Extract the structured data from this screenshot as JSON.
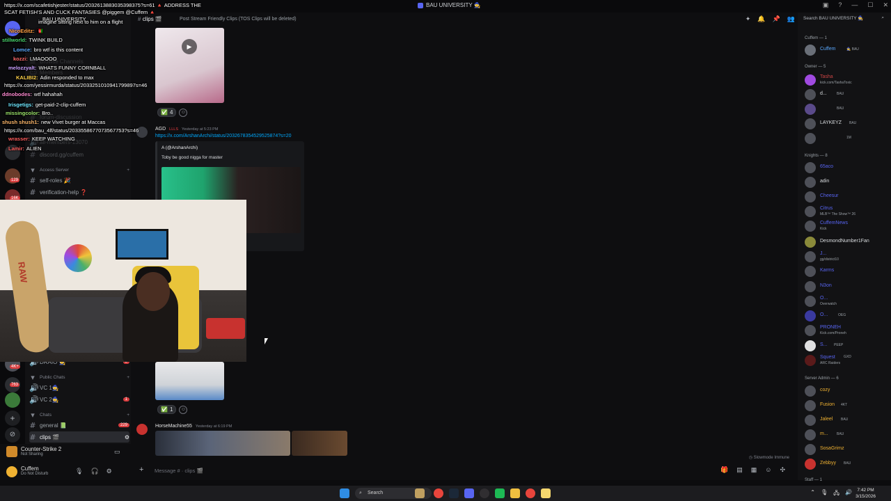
{
  "titlebar": {
    "server": "BAU UNIVERSITY 🧙",
    "icons": [
      "inbox-icon",
      "help-icon",
      "minimize-icon",
      "maximize-icon",
      "close-icon"
    ]
  },
  "overlay_chat": [
    {
      "user": "",
      "text": "https://x.com/scafetishjester/status/2032613883035398375?s=61 🔺 ADDRESS THE",
      "color": "#ffffff"
    },
    {
      "user": "",
      "text": "SCAT FETISH'S AND CUCK FANTASIES @piggem @Cuffem 🔺",
      "color": "#ffffff"
    },
    {
      "user": "",
      "text": "BAU UNIVERSITY",
      "color": "#ffffff"
    },
    {
      "user": "",
      "text": "imagine sitting next to him on a flight",
      "color": "#ffffff"
    },
    {
      "user": "NicoEditz:",
      "text": "🇦🇫",
      "color": "#ff9f43"
    },
    {
      "user": "stillworld:",
      "text": "TWINK BUILD",
      "color": "#4ad66d"
    },
    {
      "user": "Lomce:",
      "text": "bro wtf is this content",
      "color": "#5aa9ff"
    },
    {
      "user": "kozzi:",
      "text": "LMAOOOO",
      "color": "#ff6b6b"
    },
    {
      "user": "melozzyalt:",
      "text": "WHATS FUNNY CORNBALL",
      "color": "#c9a0ff"
    },
    {
      "user": "KALIBI2:",
      "text": "Adin responded to max",
      "color": "#ffd24a"
    },
    {
      "user": "",
      "text": "https://x.com/yessirmurda/status/2033251010941799897s=46",
      "color": "#ffffff"
    },
    {
      "user": "ddnobodes:",
      "text": "wtf hahahah",
      "color": "#ff8ad1"
    },
    {
      "user": "Irisgetigs:",
      "text": "get-paid-2-clip-cuffem",
      "color": "#6ee7ff"
    },
    {
      "user": "missingcolor:",
      "text": "Bro..",
      "color": "#9be36a"
    },
    {
      "user": "shush shush1:",
      "text": "new Vivet burger at Maccas",
      "color": "#ffb86b"
    },
    {
      "user": "",
      "text": "https://x.com/bau_4lf/status/2033558677073567753?s=46",
      "color": "#ffffff"
    },
    {
      "user": "wrasser:",
      "text": "KEEP WATCHING",
      "color": "#ff5e5e"
    },
    {
      "user": "Lamir:",
      "text": "ALIEN",
      "color": "#ff5e5e"
    }
  ],
  "channels": {
    "faded": [
      "Browse Channels",
      "Members",
      "forum-discussion",
      "all-members-13070",
      "discord.gg/cuffem"
    ],
    "access_category": "Access Server",
    "access_items": [
      {
        "name": "self-roles 🎉"
      },
      {
        "name": "verification-help ❓"
      }
    ],
    "lower_items": [
      {
        "name": "DRAIO 🧙",
        "count": "8"
      },
      {
        "name": "Public Chats",
        "kind": "category"
      },
      {
        "name": "VC 1🧙",
        "voice": true
      },
      {
        "name": "VC 2🧙",
        "voice": true,
        "count": "1"
      },
      {
        "name": "Chats",
        "kind": "category"
      },
      {
        "name": "general 📗",
        "count": "229"
      },
      {
        "name": "clips 🎬",
        "active": true
      }
    ]
  },
  "rail": {
    "badges": [
      "129",
      "16K",
      "4K+",
      "763"
    ]
  },
  "userbar": {
    "game": "Counter-Strike 2",
    "game_status": "Not Sharing",
    "username": "Cuffem",
    "status": "Do Not Disturb"
  },
  "main": {
    "channel": "clips 🎬",
    "topic": "Post Stream Friendly Clips (TOS Clips will be deleted)",
    "msg1": {
      "reaction": "✅",
      "count": "4"
    },
    "msg2": {
      "author": "AGD",
      "tag": "LLLS",
      "time": "Yesterday at 5:23 PM",
      "link": "https://x.com/ArshanArchi/status/2032678354529525874?s=20",
      "embed_author": "A (@ArshanArchi)",
      "embed_text": "Toby be good nigga for master"
    },
    "msg3": {
      "reaction": "✅",
      "count": "1"
    },
    "msg4": {
      "author": "HorseMachine55",
      "time": "Yesterday at 6:19 PM"
    },
    "slowmode": "Slowmode Immune",
    "composer_placeholder": "Message # · clips 🎬"
  },
  "members": {
    "search": "Search BAU UNIVERSITY 🧙",
    "sections": [
      {
        "title": "Cuffem — 1",
        "items": [
          {
            "name": "Cuffem",
            "badge": "🧙 BAU",
            "color": "#5aa9ff"
          }
        ]
      },
      {
        "title": "Owner — 5",
        "items": [
          {
            "name": "Tasha",
            "badge": "BAU",
            "color": "#c44",
            "sub": "kick.com/TashaToxic"
          },
          {
            "name": "d...",
            "badge": "BAU",
            "color": "#dbdee1"
          },
          {
            "name": "",
            "badge": "BAU",
            "color": "#dbdee1"
          },
          {
            "name": "LAYKEYZ",
            "badge": "BAU",
            "color": "#dbdee1"
          },
          {
            "name": "",
            "badge": "1M",
            "color": "#dbdee1"
          }
        ]
      },
      {
        "title": "Knights — 8",
        "items": [
          {
            "name": "65aco",
            "color": "#5865f2"
          },
          {
            "name": "adin",
            "color": "#dbdee1"
          },
          {
            "name": "Cheesur",
            "color": "#5865f2"
          },
          {
            "name": "Citrus",
            "color": "#5865f2",
            "sub": "MLB™ The Show™ 26"
          },
          {
            "name": "CuffemNews",
            "color": "#5865f2",
            "sub": "Kick"
          },
          {
            "name": "DesmondNumber1Fan",
            "color": "#dbdee1"
          },
          {
            "name": "J...",
            "color": "#5865f2",
            "sub": "gg/district10"
          },
          {
            "name": "Karms",
            "color": "#5865f2"
          },
          {
            "name": "N3on",
            "color": "#5865f2"
          },
          {
            "name": "O...",
            "color": "#5865f2",
            "sub": "Overwatch"
          },
          {
            "name": "O...",
            "badge": "OEG",
            "color": "#5865f2"
          },
          {
            "name": "PRONEH",
            "color": "#5865f2",
            "sub": "Kick.com/Proneh"
          },
          {
            "name": "S...",
            "badge": "PEEP",
            "color": "#5865f2"
          },
          {
            "name": "Squest",
            "badge": "GXD",
            "color": "#5865f2",
            "sub": "ARC Raiders"
          }
        ]
      },
      {
        "title": "Server Admin — 6",
        "items": [
          {
            "name": "cozy",
            "color": "#f0b232"
          },
          {
            "name": "Fusion",
            "badge": "4KT",
            "color": "#f0b232"
          },
          {
            "name": "Jaleel",
            "badge": "BAU",
            "color": "#f0b232"
          },
          {
            "name": "m...",
            "badge": "BAU",
            "color": "#f0b232"
          },
          {
            "name": "SosaGrimz",
            "color": "#f0b232"
          },
          {
            "name": "Zebbyy",
            "badge": "BAU",
            "color": "#f0b232"
          }
        ]
      },
      {
        "title": "Staff — 1",
        "items": []
      }
    ]
  },
  "taskbar": {
    "search": "Search",
    "time": "7:42 PM",
    "date": "3/15/2026",
    "apps": [
      "start-icon",
      "search",
      "widgets-icon",
      "chrome-icon",
      "steam-icon",
      "discord-icon",
      "obs-icon",
      "spotify-icon",
      "folder-icon",
      "chrome-icon",
      "extra-app-icon"
    ]
  }
}
